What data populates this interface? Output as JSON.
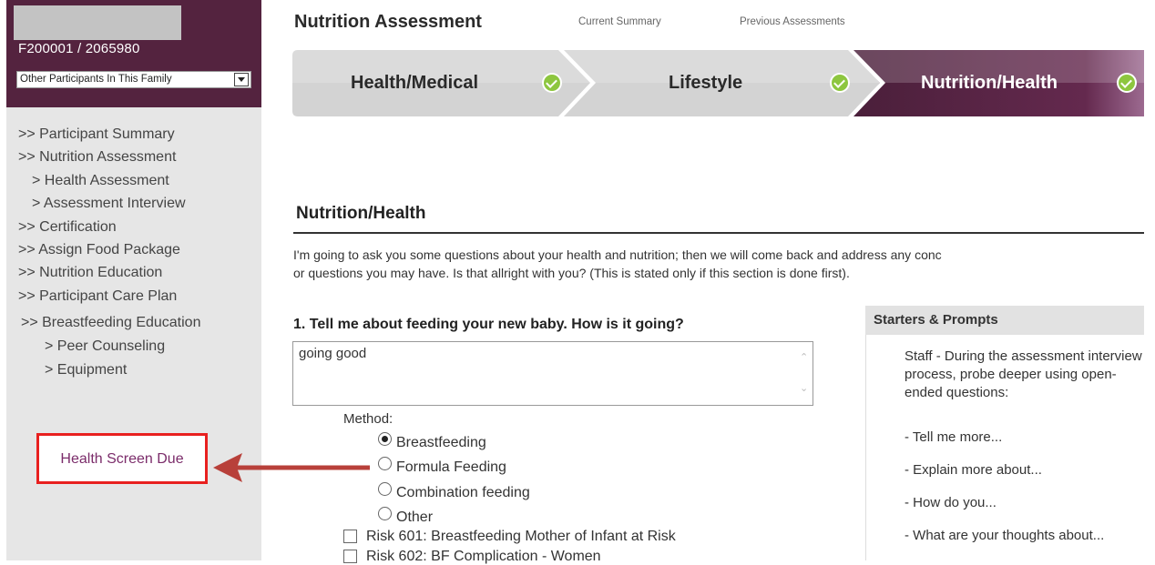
{
  "sidebar": {
    "participant_id": "F200001 / 2065980",
    "family_select": "Other Participants In This Family",
    "nav": [
      {
        "label": ">> Participant Summary",
        "level": 0
      },
      {
        "label": ">> Nutrition Assessment",
        "level": 0
      },
      {
        "label": "> Health Assessment",
        "level": 1
      },
      {
        "label": "> Assessment Interview",
        "level": 1
      },
      {
        "label": ">> Certification",
        "level": 0
      },
      {
        "label": ">> Assign Food Package",
        "level": 0
      },
      {
        "label": ">> Nutrition Education",
        "level": 0
      },
      {
        "label": ">> Participant Care Plan",
        "level": 0
      },
      {
        "label": ">> Breastfeeding Education",
        "level": 0
      },
      {
        "label": "> Peer Counseling",
        "level": 1
      },
      {
        "label": "> Equipment",
        "level": 1
      }
    ],
    "health_screen": "Health Screen Due"
  },
  "header": {
    "title": "Nutrition Assessment",
    "links": [
      "Current Summary",
      "Previous Assessments"
    ]
  },
  "steps": [
    {
      "label": "Health/Medical",
      "complete": true
    },
    {
      "label": "Lifestyle",
      "complete": true
    },
    {
      "label": "Nutrition/Health",
      "complete": true,
      "active": true
    }
  ],
  "section": {
    "title": "Nutrition/Health",
    "intro_line1": "I'm going to ask you some questions about your health and nutrition; then we will come back and address any conc",
    "intro_line2": "or questions you may have. Is that allright with you? (This is stated only if this section is done first)."
  },
  "question1": {
    "text": "1. Tell me about feeding your new baby. How is it going?",
    "answer": "going good",
    "method_label": "Method:",
    "options": [
      "Breastfeeding",
      "Formula Feeding",
      "Combination feeding",
      "Other"
    ],
    "selected": "Breastfeeding",
    "risks": [
      "Risk 601: Breastfeeding Mother of Infant at Risk",
      "Risk 602: BF Complication - Women"
    ]
  },
  "starters": {
    "title": "Starters & Prompts",
    "intro": "Staff - During the assessment interview process, probe deeper using open-ended questions:",
    "prompts": [
      "- Tell me more...",
      "- Explain more about...",
      "- How do you...",
      "- What are your thoughts about..."
    ]
  },
  "colors": {
    "brand_purple": "#54233f",
    "check_green": "#8dc63f",
    "alert_red": "#e8201f",
    "link_purple": "#7b2c6a"
  }
}
